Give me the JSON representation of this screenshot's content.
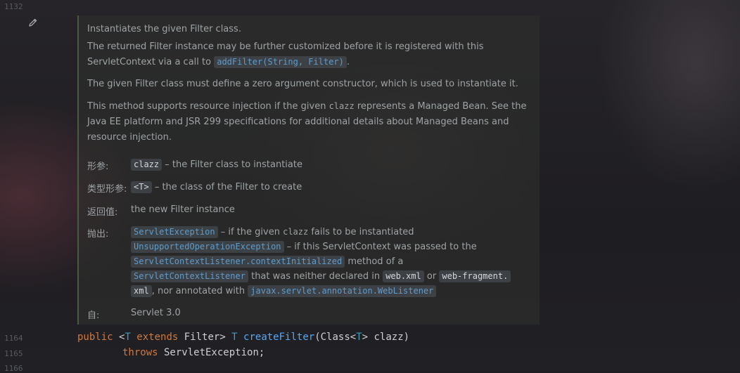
{
  "gutter": {
    "line_top": "1132",
    "line_1": "1164",
    "line_2": "1165",
    "line_3": "1166"
  },
  "doc": {
    "p1": "Instantiates the given Filter class.",
    "p2_line1": "The returned Filter instance may be further customized before it is registered with this",
    "p2_line2_pre": "ServletContext via a call to",
    "p2_code": "addFilter(String, Filter)",
    "p2_post": ".",
    "p3": "The given Filter class must define a zero argument constructor, which is used to instantiate it.",
    "p4_line1_pre": "This method supports resource injection if the given",
    "p4_line1_mono": "clazz",
    "p4_line1_post": "represents a Managed Bean. See the",
    "p4_line2": "Java EE platform and JSR 299 specifications for additional details about Managed Beans and",
    "p4_line3": "resource injection.",
    "params_label": "形参:",
    "params_code": "clazz",
    "params_desc": "– the Filter class to instantiate",
    "typeparams_label": "类型形参:",
    "typeparams_code": "<T>",
    "typeparams_desc": "– the class of the Filter to create",
    "returns_label": "返回值:",
    "returns_value": "the new Filter instance",
    "throws_label": "抛出:",
    "throws_l1_code": "ServletException",
    "throws_l1_pre": "– if the given",
    "throws_l1_mono": "clazz",
    "throws_l1_post": "fails to be instantiated",
    "throws_l2_code": "UnsupportedOperationException",
    "throws_l2_desc": "– if this ServletContext was passed to the",
    "throws_l3_code": "ServletContextListener.contextInitialized",
    "throws_l3_desc": "method of a",
    "throws_l4_code": "ServletContextListener",
    "throws_l4_desc": "that was neither declared in",
    "throws_l4_code2": "web.xml",
    "throws_l4_or": "or",
    "throws_l4_code3": "web-fragment.",
    "throws_l5_code": "xml",
    "throws_l5_desc": ", nor annotated with",
    "throws_l5_code2": "javax.servlet.annotation.WebListener",
    "since_label": "自:",
    "since_value": "Servlet 3.0"
  },
  "source": {
    "l1_public": "public",
    "l1_lt": " <",
    "l1_T": "T",
    "l1_extends": " extends",
    "l1_filter": " Filter> ",
    "l1_T2": "T",
    "l1_name": " createFilter",
    "l1_paren": "(Class<",
    "l1_T3": "T",
    "l1_rest": "> clazz)",
    "l2_throws": "throws",
    "l2_rest": " ServletException;"
  },
  "icons": {
    "edit": "pencil-icon"
  }
}
